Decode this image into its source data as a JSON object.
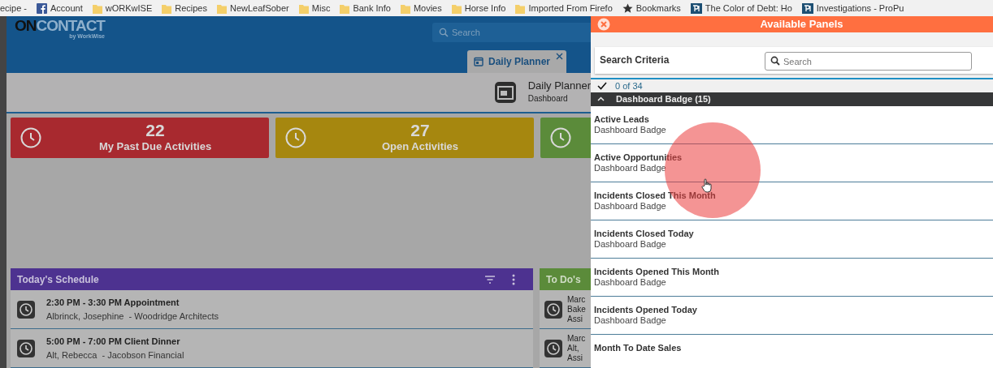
{
  "bookmarks": [
    {
      "kind": "text",
      "label": "ecipe -"
    },
    {
      "kind": "facebook",
      "label": "Account"
    },
    {
      "kind": "folder",
      "label": "wORKwISE"
    },
    {
      "kind": "folder",
      "label": "Recipes"
    },
    {
      "kind": "folder",
      "label": "NewLeafSober"
    },
    {
      "kind": "folder",
      "label": "Misc"
    },
    {
      "kind": "folder",
      "label": "Bank Info"
    },
    {
      "kind": "folder",
      "label": "Movies"
    },
    {
      "kind": "folder",
      "label": "Horse Info"
    },
    {
      "kind": "folder",
      "label": "Imported From Firefo"
    },
    {
      "kind": "star",
      "label": "Bookmarks"
    },
    {
      "kind": "site",
      "label": "The Color of Debt: Ho"
    },
    {
      "kind": "site",
      "label": "Investigations - ProPu"
    }
  ],
  "app": {
    "logo": {
      "dark": "ON",
      "light": "CONTACT",
      "tagline": "by WorkWise"
    },
    "search": {
      "placeholder": "Search"
    },
    "tabs": [
      {
        "label": "Daily Planner",
        "selected": true
      }
    ],
    "page": {
      "title": "Daily Planner",
      "subtitle": "Dashboard"
    },
    "badges": [
      {
        "count": "22",
        "label": "My Past Due Activities",
        "color": "#a8292f"
      },
      {
        "count": "27",
        "label": "Open Activities",
        "color": "#a6870f"
      },
      {
        "color": "#5b8b3a"
      }
    ],
    "schedule": {
      "title": "Today's Schedule",
      "rows": [
        {
          "time": "2:30 PM - 3:30 PM Appointment",
          "detail": "Albrinck, Josephine  - Woodridge Architects"
        },
        {
          "time": "5:00 PM - 7:00 PM Client Dinner",
          "detail": "Alt, Rebecca  - Jacobson Financial"
        }
      ]
    },
    "todos": {
      "title": "To Do's",
      "rows": [
        {
          "lines": [
            "Marc",
            "Bake",
            "Assi"
          ]
        },
        {
          "lines": [
            "Marc",
            "Alt,",
            "Assi"
          ]
        }
      ]
    }
  },
  "panel": {
    "title": "Available Panels",
    "search_label": "Search Criteria",
    "search": {
      "placeholder": "Search"
    },
    "count": "0 of 34",
    "group": {
      "title": "Dashboard Badge (15)",
      "expanded": true,
      "items": [
        {
          "name": "Active Leads",
          "type": "Dashboard Badge"
        },
        {
          "name": "Active Opportunities",
          "type": "Dashboard Badge"
        },
        {
          "name": "Incidents Closed This Month",
          "type": "Dashboard Badge"
        },
        {
          "name": "Incidents Closed Today",
          "type": "Dashboard Badge"
        },
        {
          "name": "Incidents Opened This Month",
          "type": "Dashboard Badge"
        },
        {
          "name": "Incidents Opened Today",
          "type": "Dashboard Badge"
        },
        {
          "name": "Month To Date Sales"
        }
      ]
    }
  }
}
